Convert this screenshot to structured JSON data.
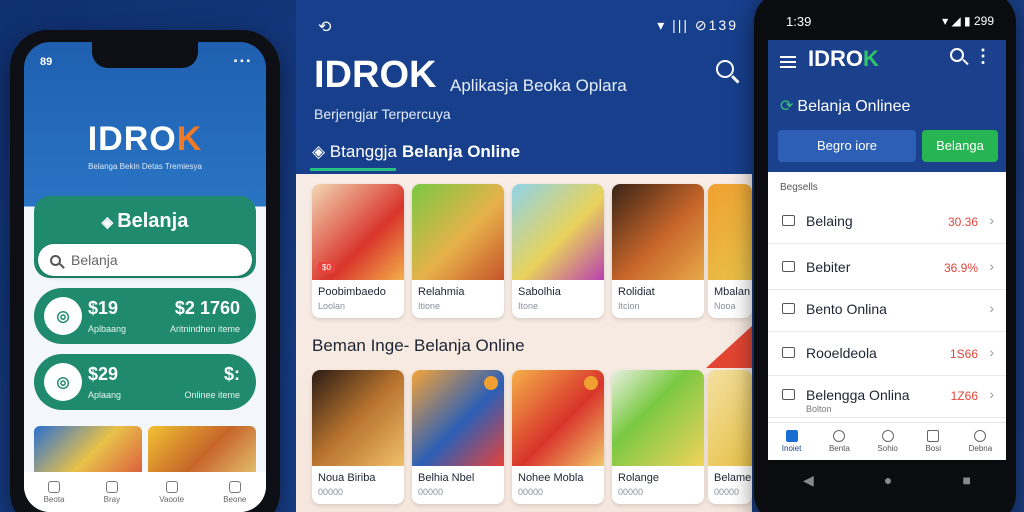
{
  "left_phone": {
    "time": "89",
    "status": "▪ ▪ ▪",
    "brand_main": "IDRO",
    "brand_k": "K",
    "brand_sub": "Belanga Bekin Detas Tremiesya",
    "card_title": "Belanja",
    "search_placeholder": "Belanja",
    "stats": [
      {
        "circle": "◎",
        "value": "$19",
        "value2": "$2 1760",
        "label": "Aplbaang",
        "label2": "Aritnindhen iteme"
      },
      {
        "circle": "◎",
        "value": "$29",
        "value2": "$:",
        "label": "Aplaang",
        "label2": "Onlinee iteme"
      }
    ],
    "nav": [
      "Beota",
      "Bray",
      "Vaoote",
      "Beone"
    ]
  },
  "center": {
    "status_icons": "▾ ||| ⊘139",
    "brand": "IDROK",
    "tagline": "Aplikasja Beoka Oplara",
    "subtitle": "Berjengjar Terpercuya",
    "tab1": "Btanggja",
    "tab2": "Belanja Online",
    "products_top": [
      {
        "title": "Poobimbaedo",
        "sub": "Loolan",
        "badge": "$0"
      },
      {
        "title": "Relahmia",
        "sub": "Itione",
        "badge": ""
      },
      {
        "title": "Sabolhia",
        "sub": "Itone",
        "badge": ""
      },
      {
        "title": "Rolidiat",
        "sub": "Itcion",
        "badge": ""
      },
      {
        "title": "Mbalan",
        "sub": "Nooa",
        "badge": ""
      }
    ],
    "section_title": "Beman Inge- Belanja Online",
    "products_bottom": [
      {
        "title": "Noua Biriba",
        "sub": "00000"
      },
      {
        "title": "Belhia Nbel",
        "sub": "00000"
      },
      {
        "title": "Nohee Mobla",
        "sub": "00000"
      },
      {
        "title": "Rolange",
        "sub": "00000"
      },
      {
        "title": "Belame",
        "sub": "00000"
      }
    ]
  },
  "right_phone": {
    "time": "1:39",
    "status": "▾ ◢ ▮ 299",
    "brand_main": "IDRO",
    "brand_k": "K",
    "dots": "⋮",
    "belanja_online": "Belanja Onlinee",
    "btn1": "Begro iore",
    "btn2": "Belanga",
    "list_label": "Begsells",
    "rows": [
      {
        "title": "Belaing",
        "price": "30.36",
        "sub": ""
      },
      {
        "title": "Bebiter",
        "price": "36.9%",
        "sub": ""
      },
      {
        "title": "Bento Onlina",
        "price": "",
        "sub": ""
      },
      {
        "title": "Rooeldeola",
        "price": "1S66",
        "sub": ""
      },
      {
        "title": "Belengga Onlina",
        "price": "1Z66",
        "sub": "Bolton"
      }
    ],
    "nav": [
      "Inoiet",
      "Benta",
      "Sohio",
      "Bosi",
      "Debna"
    ],
    "sys": [
      "◀",
      "●",
      "■"
    ]
  },
  "colors": {
    "primary": "#173f8c",
    "green": "#1f8a6d",
    "accent_green": "#27b553",
    "accent_orange": "#f07b24",
    "price_red": "#e2463a"
  }
}
